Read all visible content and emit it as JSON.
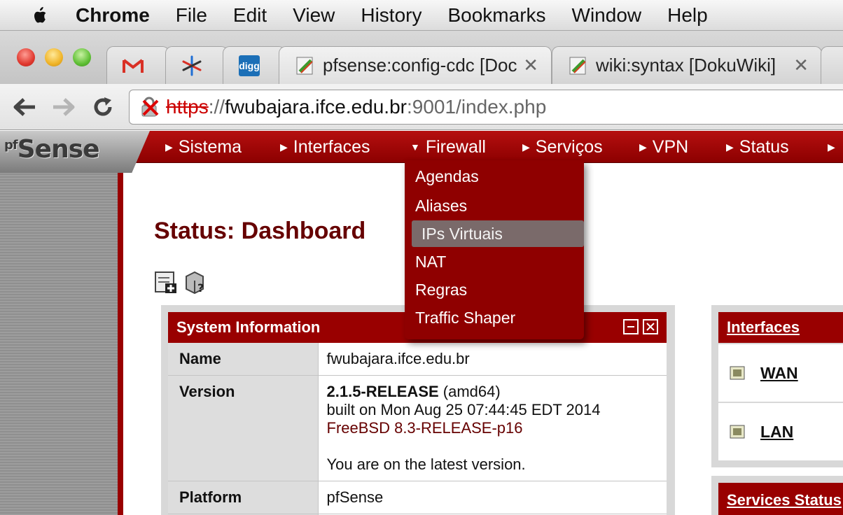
{
  "menubar": {
    "app": "Chrome",
    "items": [
      "File",
      "Edit",
      "View",
      "History",
      "Bookmarks",
      "Window",
      "Help"
    ]
  },
  "tabs": [
    {
      "icon": "gmail-icon"
    },
    {
      "icon": "asterisk-icon"
    },
    {
      "icon": "digg-icon",
      "icon_text": "digg"
    },
    {
      "icon": "dokuwiki-icon",
      "title": "pfsense:config-cdc [Docum"
    },
    {
      "icon": "dokuwiki-icon",
      "title": "wiki:syntax [DokuWiki]"
    }
  ],
  "tab_close_glyph": "✕",
  "address": {
    "scheme": "https",
    "sep": "://",
    "host": "fwubajara.ifce.edu.br",
    "rest": ":9001/index.php"
  },
  "pf": {
    "logo_pf": "pf",
    "logo": "Sense",
    "nav": [
      "Sistema",
      "Interfaces",
      "Firewall",
      "Serviços",
      "VPN",
      "Status"
    ],
    "firewall_menu": [
      "Agendas",
      "Aliases",
      "IPs Virtuais",
      "NAT",
      "Regras",
      "Traffic Shaper"
    ],
    "title": "Status: Dashboard",
    "sysinfo": {
      "heading": "System Information",
      "rows": {
        "name_k": "Name",
        "name_v": "fwubajara.ifce.edu.br",
        "version_k": "Version",
        "version_release": "2.1.5-RELEASE",
        "version_arch": "(amd64)",
        "version_built": "built on Mon Aug 25 07:44:45 EDT 2014",
        "version_freebsd": "FreeBSD 8.3-RELEASE-p16",
        "version_latest": "You are on the latest version.",
        "platform_k": "Platform",
        "platform_v": "pfSense"
      }
    },
    "interfaces": {
      "heading": "Interfaces",
      "items": [
        "WAN",
        "LAN"
      ]
    },
    "services_heading": "Services Status"
  },
  "colors": {
    "pf_red": "#990000",
    "title_red": "#660000",
    "dropdown_red": "#8f0000",
    "selected_gray": "#7a6a6a"
  }
}
